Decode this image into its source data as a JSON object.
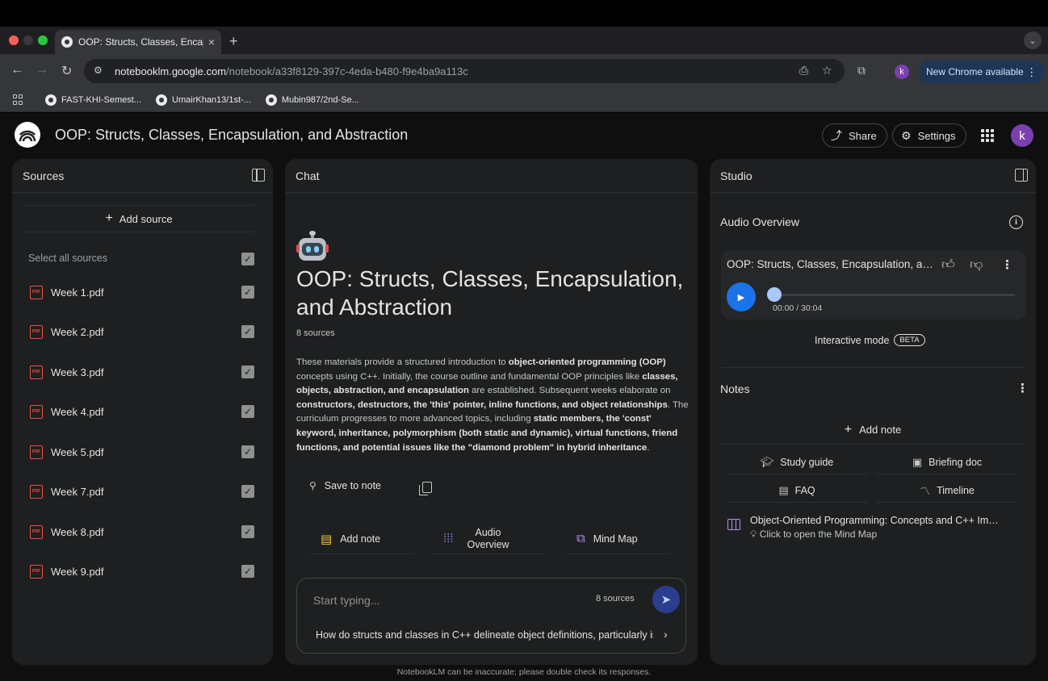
{
  "browser": {
    "tab_title": "OOP: Structs, Classes, Encapsulation",
    "tab_close": "×",
    "new_tab": "+",
    "tab_menu": "⌄",
    "url_host": "notebooklm.google.com",
    "url_path": "/notebook/a33f8129-397c-4eda-b480-f9e4ba9a113c",
    "profile_initial": "k",
    "new_chrome_label": "New Chrome available",
    "bookmarks": [
      {
        "label": "FAST-KHI-Semest..."
      },
      {
        "label": "UmairKhan13/1st-..."
      },
      {
        "label": "Mubin987/2nd-Se..."
      }
    ]
  },
  "app": {
    "notebook_title": "OOP: Structs, Classes, Encapsulation, and Abstraction",
    "share_label": "Share",
    "settings_label": "Settings",
    "avatar_initial": "k"
  },
  "sources": {
    "title": "Sources",
    "add_source_label": "Add source",
    "select_all_label": "Select all sources",
    "items": [
      {
        "name": "Week 1.pdf",
        "checked": true
      },
      {
        "name": "Week 2.pdf",
        "checked": true
      },
      {
        "name": "Week 3.pdf",
        "checked": true
      },
      {
        "name": "Week 4.pdf",
        "checked": true
      },
      {
        "name": "Week 5.pdf",
        "checked": true
      },
      {
        "name": "Week 7.pdf",
        "checked": true
      },
      {
        "name": "Week 8.pdf",
        "checked": true
      },
      {
        "name": "Week 9.pdf",
        "checked": true
      }
    ],
    "pdf_badge": "PDF"
  },
  "chat": {
    "title": "Chat",
    "notebook_heading": "OOP: Structs, Classes, Encapsulation, and Abstraction",
    "source_count": "8 sources",
    "summary_segments": [
      {
        "text": "These materials provide a structured introduction to ",
        "bold": false
      },
      {
        "text": "object-oriented programming (OOP)",
        "bold": true
      },
      {
        "text": " concepts using C++. Initially, the course outline and fundamental OOP principles like ",
        "bold": false
      },
      {
        "text": "classes, objects, abstraction, and encapsulation",
        "bold": true
      },
      {
        "text": " are established. Subsequent weeks elaborate on ",
        "bold": false
      },
      {
        "text": "constructors, destructors, the 'this' pointer, inline functions, and object relationships",
        "bold": true
      },
      {
        "text": ". The curriculum progresses to more advanced topics, including ",
        "bold": false
      },
      {
        "text": "static members, the 'const' keyword, inheritance, polymorphism (both static and dynamic), virtual functions, friend functions, and potential issues like the \"diamond problem\" in hybrid inheritance",
        "bold": true
      },
      {
        "text": ".",
        "bold": false
      }
    ],
    "save_to_note_label": "Save to note",
    "quick_actions": {
      "add_note": "Add note",
      "audio_overview": "Audio Overview",
      "mind_map": "Mind Map"
    },
    "input_placeholder": "Start typing...",
    "input_source_count": "8 sources",
    "suggestion": "How do structs and classes in C++ delineate object definitions, particularly in terms of default access?"
  },
  "studio": {
    "title": "Studio",
    "audio_overview_title": "Audio Overview",
    "audio_item_title": "OOP: Structs, Classes, Encapsulation, and Abstraction",
    "audio_time": "00:00 / 30:04",
    "audio_progress": 0.0,
    "interactive_mode_label": "Interactive mode",
    "beta_label": "BETA",
    "notes_title": "Notes",
    "add_note_label": "Add note",
    "note_buttons": {
      "study_guide": "Study guide",
      "briefing_doc": "Briefing doc",
      "faq": "FAQ",
      "timeline": "Timeline"
    },
    "mind_map_note_title": "Object-Oriented Programming: Concepts and C++ Implementation",
    "mind_map_note_subtitle": "Click to open the Mind Map"
  },
  "footer": {
    "disclaimer": "NotebookLM can be inaccurate; please double check its responses."
  },
  "colors": {
    "accent_blue": "#1a73e8",
    "send_button": "#2a3d8f",
    "pdf_red": "#e5534b",
    "mind_map_purple": "#b98ef0",
    "add_note_yellow": "#f2c94c",
    "audio_purple": "#8a7cf0",
    "avatar_purple": "#7a3fb0"
  }
}
